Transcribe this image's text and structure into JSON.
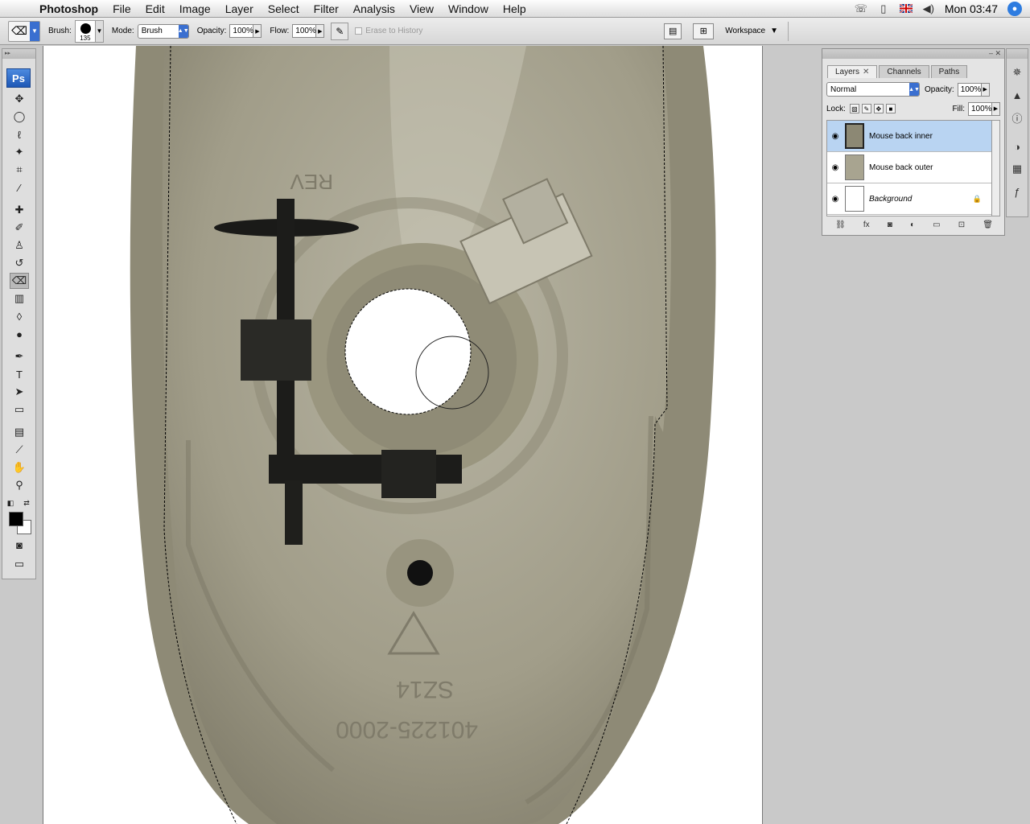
{
  "menubar": {
    "app": "Photoshop",
    "items": [
      "File",
      "Edit",
      "Image",
      "Layer",
      "Select",
      "Filter",
      "Analysis",
      "View",
      "Window",
      "Help"
    ],
    "clock": "Mon 03:47"
  },
  "options": {
    "brush_label": "Brush:",
    "brush_size": "135",
    "mode_label": "Mode:",
    "mode_value": "Brush",
    "opacity_label": "Opacity:",
    "opacity_value": "100%",
    "flow_label": "Flow:",
    "flow_value": "100%",
    "erase_history_label": "Erase to History",
    "workspace_label": "Workspace"
  },
  "toolbox": {
    "logo": "Ps"
  },
  "layers_panel": {
    "tabs": [
      "Layers",
      "Channels",
      "Paths"
    ],
    "blend_mode": "Normal",
    "opacity_label": "Opacity:",
    "opacity_value": "100%",
    "lock_label": "Lock:",
    "fill_label": "Fill:",
    "fill_value": "100%",
    "layers": [
      {
        "name": "Mouse back inner",
        "selected": true
      },
      {
        "name": "Mouse back outer",
        "selected": false
      },
      {
        "name": "Background",
        "selected": false,
        "locked": true
      }
    ]
  },
  "canvas": {
    "text_upper": "REV",
    "text_model": "SZ14",
    "text_serial": "401225-2000"
  },
  "colors": {
    "accent": "#3a6fd0",
    "selection": "#b9d4f2",
    "plastic": "#a19d89"
  }
}
